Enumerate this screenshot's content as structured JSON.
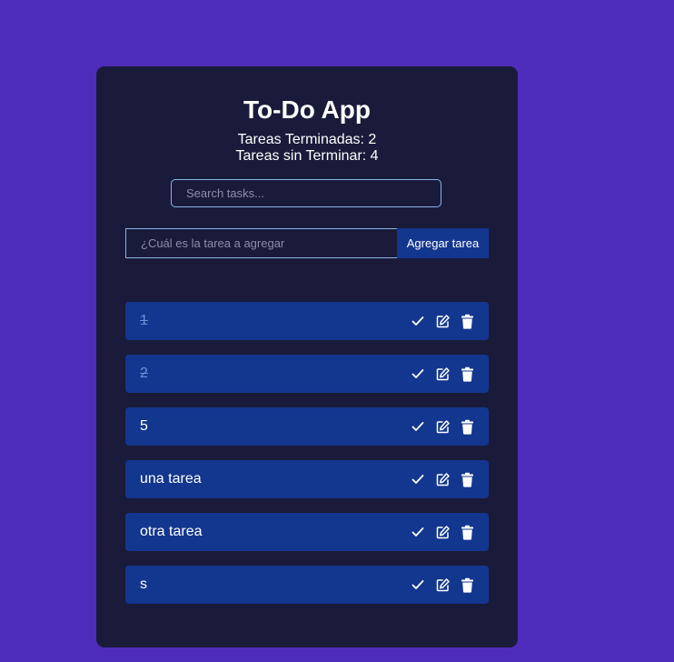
{
  "app": {
    "title": "To-Do App",
    "completed_text": "Tareas Terminadas: 2",
    "pending_text": "Tareas sin Terminar: 4"
  },
  "search": {
    "placeholder": "Search tasks..."
  },
  "new_task": {
    "placeholder": "¿Cuál es la tarea a agregar",
    "button_label": "Agregar tarea"
  },
  "tasks": [
    {
      "text": "1",
      "done": true
    },
    {
      "text": "2",
      "done": true
    },
    {
      "text": "5",
      "done": false
    },
    {
      "text": "una tarea",
      "done": false
    },
    {
      "text": "otra tarea",
      "done": false
    },
    {
      "text": "s",
      "done": false
    }
  ],
  "icons": {
    "complete": "check-icon",
    "edit": "edit-icon",
    "delete": "trash-icon"
  },
  "colors": {
    "background": "#4f2dbc",
    "card": "#1a1b3a",
    "accent": "#13378f",
    "done_text": "#6f8fd6"
  }
}
